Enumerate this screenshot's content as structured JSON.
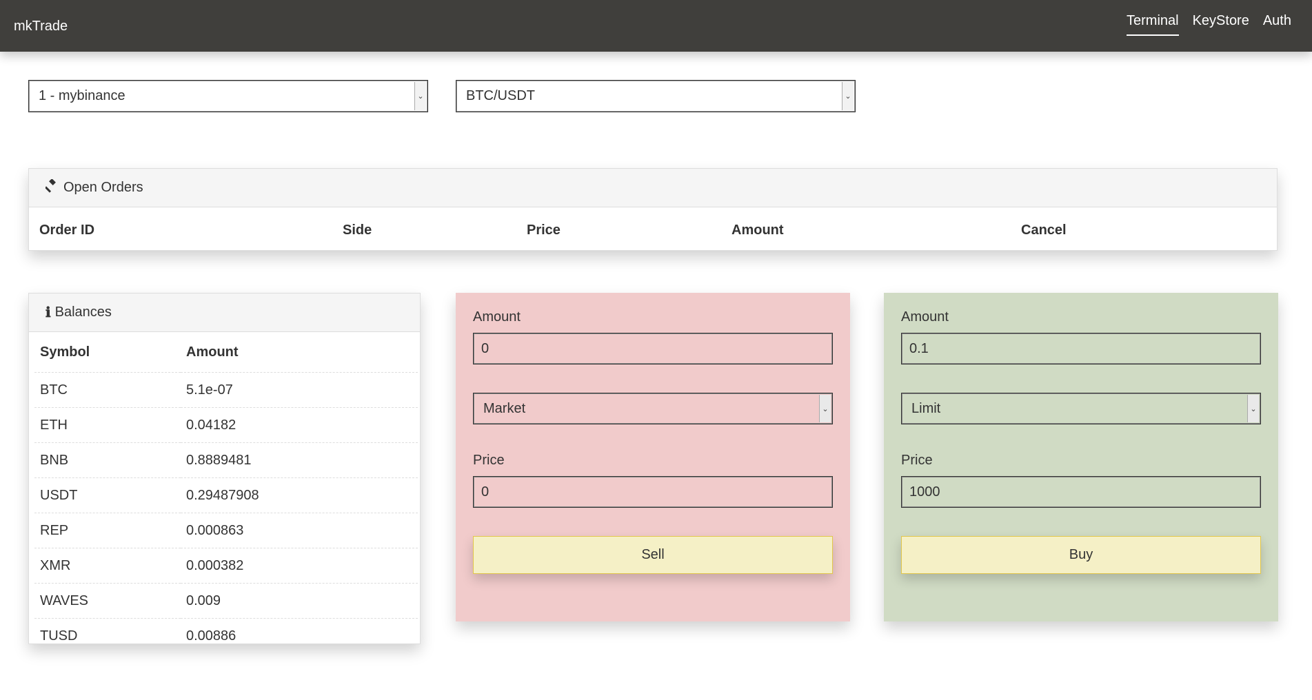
{
  "navbar": {
    "brand": "mkTrade",
    "links": [
      "Terminal",
      "KeyStore",
      "Auth"
    ]
  },
  "selectors": {
    "account": "1 - mybinance",
    "pair": "BTC/USDT"
  },
  "open_orders": {
    "title": "Open Orders",
    "icon": "gavel-icon",
    "columns": [
      "Order ID",
      "Side",
      "Price",
      "Amount",
      "Cancel"
    ]
  },
  "balances": {
    "title": "Balances",
    "icon": "info-icon",
    "columns": [
      "Symbol",
      "Amount"
    ],
    "rows": [
      [
        "BTC",
        "5.1e-07"
      ],
      [
        "ETH",
        "0.04182"
      ],
      [
        "BNB",
        "0.8889481"
      ],
      [
        "USDT",
        "0.29487908"
      ],
      [
        "REP",
        "0.000863"
      ],
      [
        "XMR",
        "0.000382"
      ],
      [
        "WAVES",
        "0.009"
      ],
      [
        "TUSD",
        "0.00886"
      ]
    ]
  },
  "sell": {
    "amount_label": "Amount",
    "amount": "0",
    "type": "Market",
    "price_label": "Price",
    "price": "0",
    "button": "Sell"
  },
  "buy": {
    "amount_label": "Amount",
    "amount": "0.1",
    "type": "Limit",
    "price_label": "Price",
    "price": "1000",
    "button": "Buy"
  },
  "colors": {
    "navbar": "#403f3c",
    "sell_panel": "#f1cbcb",
    "buy_panel": "#d0dbc4",
    "button": "#f5f0c6"
  }
}
